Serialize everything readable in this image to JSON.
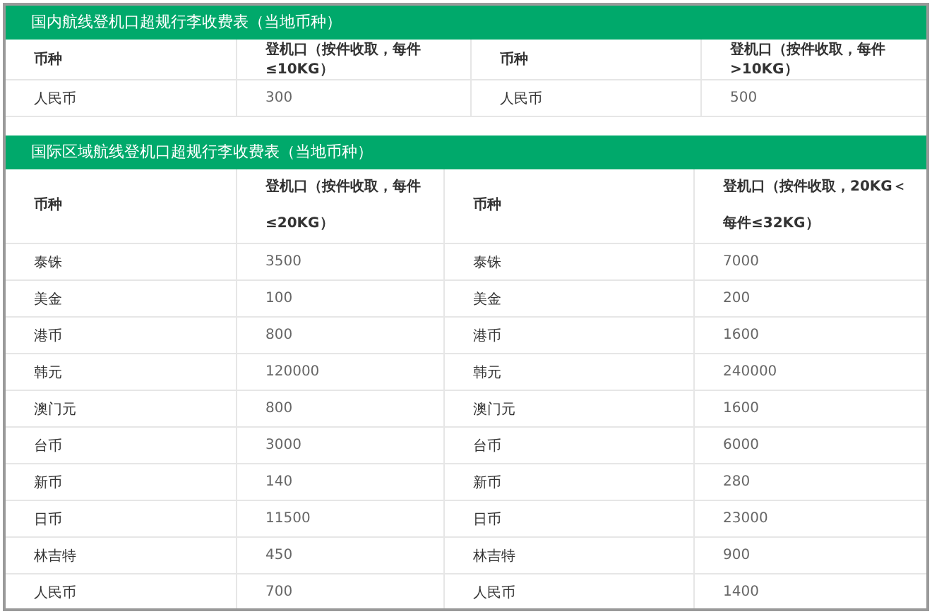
{
  "tables": [
    {
      "title": "国内航线登机口超规行李收费表（当地币种）",
      "columns": [
        "币种",
        "登机口（按件收取，每件≤10KG）",
        "币种",
        "登机口（按件收取，每件>10KG）"
      ],
      "rows": [
        [
          "人民币",
          "300",
          "人民币",
          "500"
        ]
      ]
    },
    {
      "title": "国际区域航线登机口超规行李收费表（当地币种）",
      "columns": [
        "币种",
        "登机口（按件收取，每件≤20KG）",
        "币种",
        "登机口（按件收取，20KG＜每件≤32KG）"
      ],
      "rows": [
        [
          "泰铢",
          "3500",
          "泰铢",
          "7000"
        ],
        [
          "美金",
          "100",
          "美金",
          "200"
        ],
        [
          "港币",
          "800",
          "港币",
          "1600"
        ],
        [
          "韩元",
          "120000",
          "韩元",
          "240000"
        ],
        [
          "澳门元",
          "800",
          "澳门元",
          "1600"
        ],
        [
          "台币",
          "3000",
          "台币",
          "6000"
        ],
        [
          "新币",
          "140",
          "新币",
          "280"
        ],
        [
          "日币",
          "11500",
          "日币",
          "23000"
        ],
        [
          "林吉特",
          "450",
          "林吉特",
          "900"
        ],
        [
          "人民币",
          "700",
          "人民币",
          "1400"
        ]
      ]
    }
  ]
}
